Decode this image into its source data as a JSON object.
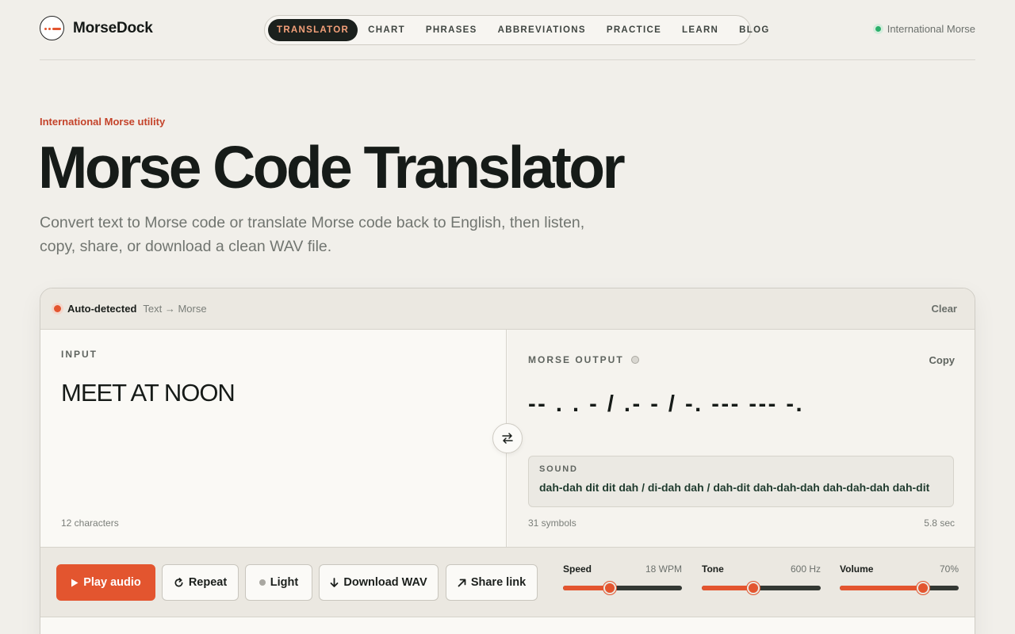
{
  "brand": {
    "name": "MorseDock"
  },
  "nav": {
    "items": [
      "TRANSLATOR",
      "CHART",
      "PHRASES",
      "ABBREVIATIONS",
      "PRACTICE",
      "LEARN",
      "BLOG"
    ],
    "active": "TRANSLATOR"
  },
  "region": {
    "label": "International Morse",
    "status_color": "#2bb06b"
  },
  "hero": {
    "kicker": "International Morse utility",
    "title": "Morse Code Translator",
    "subtitle": "Convert text to Morse code or translate Morse code back to English, then listen, copy, share, or download a clean WAV file."
  },
  "translator": {
    "status_label": "Auto-detected",
    "direction": "Text → Morse",
    "clear_label": "Clear",
    "input": {
      "label": "INPUT",
      "value": "MEET AT NOON",
      "count": "12 characters"
    },
    "output": {
      "label": "MORSE OUTPUT",
      "copy_label": "Copy",
      "morse": "-- . . - / .- - / -. --- --- -.",
      "sound_label": "SOUND",
      "sound": "dah-dah dit dit dah / di-dah dah / dah-dit dah-dah-dah dah-dah-dah dah-dit",
      "symbols": "31 symbols",
      "duration": "5.8 sec"
    },
    "swap_icon": "swap-arrows-icon"
  },
  "controls": {
    "play": "Play audio",
    "repeat": "Repeat",
    "light": "Light",
    "download": "Download WAV",
    "share": "Share link",
    "speed": {
      "label": "Speed",
      "value": "18 WPM",
      "fraction": 0.39
    },
    "tone": {
      "label": "Tone",
      "value": "600 Hz",
      "fraction": 0.43
    },
    "volume": {
      "label": "Volume",
      "value": "70%",
      "fraction": 0.7
    }
  },
  "accent_color": "#e3552f"
}
